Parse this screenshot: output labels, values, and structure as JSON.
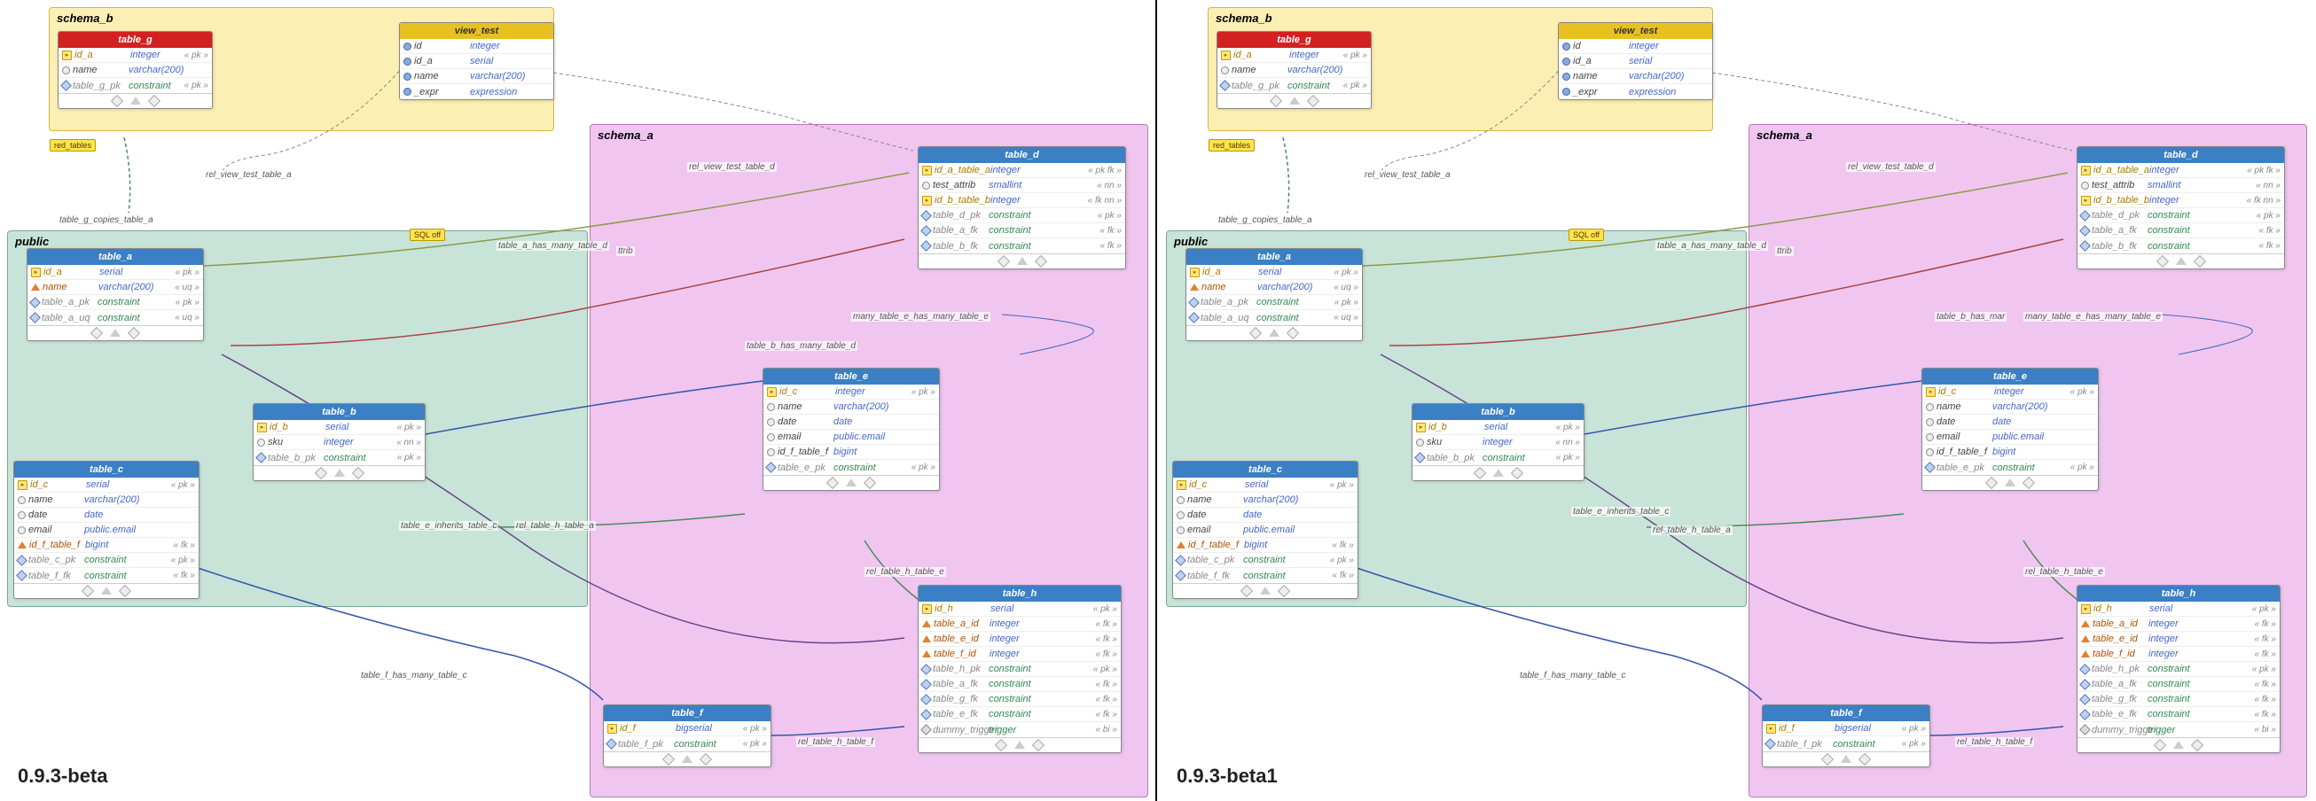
{
  "versions": {
    "left": "0.9.3-beta",
    "right": "0.9.3-beta1"
  },
  "schemas": {
    "b": "schema_b",
    "a": "schema_a",
    "pub": "public"
  },
  "badges": {
    "red_tables": "red_tables",
    "sql_off": "SQL off"
  },
  "tables": {
    "table_g": {
      "title": "table_g",
      "cols": [
        {
          "ico": "pk",
          "name": "id_a",
          "type": "integer",
          "tag": "« pk »"
        },
        {
          "ico": "circ",
          "name": "name",
          "type": "varchar(200)",
          "tag": ""
        },
        {
          "ico": "diamond-blue",
          "name": "table_g_pk",
          "type": "constraint",
          "tag": "« pk »"
        }
      ]
    },
    "view_test": {
      "title": "view_test",
      "cols": [
        {
          "ico": "circ-blue",
          "name": "id",
          "type": "integer",
          "tag": ""
        },
        {
          "ico": "circ-blue",
          "name": "id_a",
          "type": "serial",
          "tag": ""
        },
        {
          "ico": "circ-blue",
          "name": "name",
          "type": "varchar(200)",
          "tag": ""
        },
        {
          "ico": "circ-blue",
          "name": "_expr",
          "type": "expression",
          "tag": ""
        }
      ]
    },
    "table_a": {
      "title": "table_a",
      "cols": [
        {
          "ico": "pk",
          "name": "id_a",
          "type": "serial",
          "tag": "« pk »"
        },
        {
          "ico": "fk",
          "name": "name",
          "type": "varchar(200)",
          "tag": "« uq »"
        },
        {
          "ico": "diamond-blue",
          "name": "table_a_pk",
          "type": "constraint",
          "tag": "« pk »"
        },
        {
          "ico": "diamond-blue",
          "name": "table_a_uq",
          "type": "constraint",
          "tag": "« uq »"
        }
      ]
    },
    "table_b": {
      "title": "table_b",
      "cols": [
        {
          "ico": "pk",
          "name": "id_b",
          "type": "serial",
          "tag": "« pk »"
        },
        {
          "ico": "circ",
          "name": "sku",
          "type": "integer",
          "tag": "« nn »"
        },
        {
          "ico": "diamond-blue",
          "name": "table_b_pk",
          "type": "constraint",
          "tag": "« pk »"
        }
      ]
    },
    "table_c": {
      "title": "table_c",
      "cols": [
        {
          "ico": "pk",
          "name": "id_c",
          "type": "serial",
          "tag": "« pk »"
        },
        {
          "ico": "circ",
          "name": "name",
          "type": "varchar(200)",
          "tag": ""
        },
        {
          "ico": "circ",
          "name": "date",
          "type": "date",
          "tag": ""
        },
        {
          "ico": "circ",
          "name": "email",
          "type": "public.email",
          "tag": ""
        },
        {
          "ico": "fk",
          "name": "id_f_table_f",
          "type": "bigint",
          "tag": "« fk »"
        },
        {
          "ico": "diamond-blue",
          "name": "table_c_pk",
          "type": "constraint",
          "tag": "« pk »"
        },
        {
          "ico": "diamond-blue",
          "name": "table_f_fk",
          "type": "constraint",
          "tag": "« fk »"
        }
      ]
    },
    "table_d": {
      "title": "table_d",
      "cols": [
        {
          "ico": "pk",
          "name": "id_a_table_a",
          "type": "integer",
          "tag": "« pk fk »"
        },
        {
          "ico": "circ",
          "name": "test_attrib",
          "type": "smallint",
          "tag": "« nn »"
        },
        {
          "ico": "pk",
          "name": "id_b_table_b",
          "type": "integer",
          "tag": "« fk nn »"
        },
        {
          "ico": "diamond-blue",
          "name": "table_d_pk",
          "type": "constraint",
          "tag": "« pk »"
        },
        {
          "ico": "diamond-blue",
          "name": "table_a_fk",
          "type": "constraint",
          "tag": "« fk »"
        },
        {
          "ico": "diamond-blue",
          "name": "table_b_fk",
          "type": "constraint",
          "tag": "« fk »"
        }
      ]
    },
    "table_e": {
      "title": "table_e",
      "cols": [
        {
          "ico": "pk",
          "name": "id_c",
          "type": "integer",
          "tag": "« pk »"
        },
        {
          "ico": "circ",
          "name": "name",
          "type": "varchar(200)",
          "tag": ""
        },
        {
          "ico": "circ",
          "name": "date",
          "type": "date",
          "tag": ""
        },
        {
          "ico": "circ",
          "name": "email",
          "type": "public.email",
          "tag": ""
        },
        {
          "ico": "circ",
          "name": "id_f_table_f",
          "type": "bigint",
          "tag": ""
        },
        {
          "ico": "diamond-blue",
          "name": "table_e_pk",
          "type": "constraint",
          "tag": "« pk »"
        }
      ]
    },
    "table_f": {
      "title": "table_f",
      "cols": [
        {
          "ico": "pk",
          "name": "id_f",
          "type": "bigserial",
          "tag": "« pk »"
        },
        {
          "ico": "diamond-blue",
          "name": "table_f_pk",
          "type": "constraint",
          "tag": "« pk »"
        }
      ]
    },
    "table_h": {
      "title": "table_h",
      "cols": [
        {
          "ico": "pk",
          "name": "id_h",
          "type": "serial",
          "tag": "« pk »"
        },
        {
          "ico": "fk",
          "name": "table_a_id",
          "type": "integer",
          "tag": "« fk »"
        },
        {
          "ico": "fk",
          "name": "table_e_id",
          "type": "integer",
          "tag": "« fk »"
        },
        {
          "ico": "fk",
          "name": "table_f_id",
          "type": "integer",
          "tag": "« fk »"
        },
        {
          "ico": "diamond-blue",
          "name": "table_h_pk",
          "type": "constraint",
          "tag": "« pk »"
        },
        {
          "ico": "diamond-blue",
          "name": "table_a_fk",
          "type": "constraint",
          "tag": "« fk »"
        },
        {
          "ico": "diamond-blue",
          "name": "table_g_fk",
          "type": "constraint",
          "tag": "« fk »"
        },
        {
          "ico": "diamond-blue",
          "name": "table_e_fk",
          "type": "constraint",
          "tag": "« fk »"
        },
        {
          "ico": "diamond",
          "name": "dummy_trigger",
          "type": "trigger",
          "tag": "« bi »"
        }
      ]
    }
  },
  "rels": {
    "view_test_a": "rel_view_test_table_a",
    "view_test_d": "rel_view_test_table_d",
    "g_copies_a": "table_g_copies_table_a",
    "a_many_d": "table_a_has_many_table_d",
    "b_many_d": "table_b_has_many_table_d",
    "many_e_many_e": "many_table_e_has_many_table_e",
    "e_inherits_c": "table_e_inherits_table_c",
    "h_table_a": "rel_table_h_table_a",
    "h_table_e": "rel_table_h_table_e",
    "h_table_f": "rel_table_h_table_f",
    "f_many_c": "table_f_has_many_table_c",
    "b_has_mar": "table_b_has_mar",
    "ttrib": "ttrib"
  }
}
